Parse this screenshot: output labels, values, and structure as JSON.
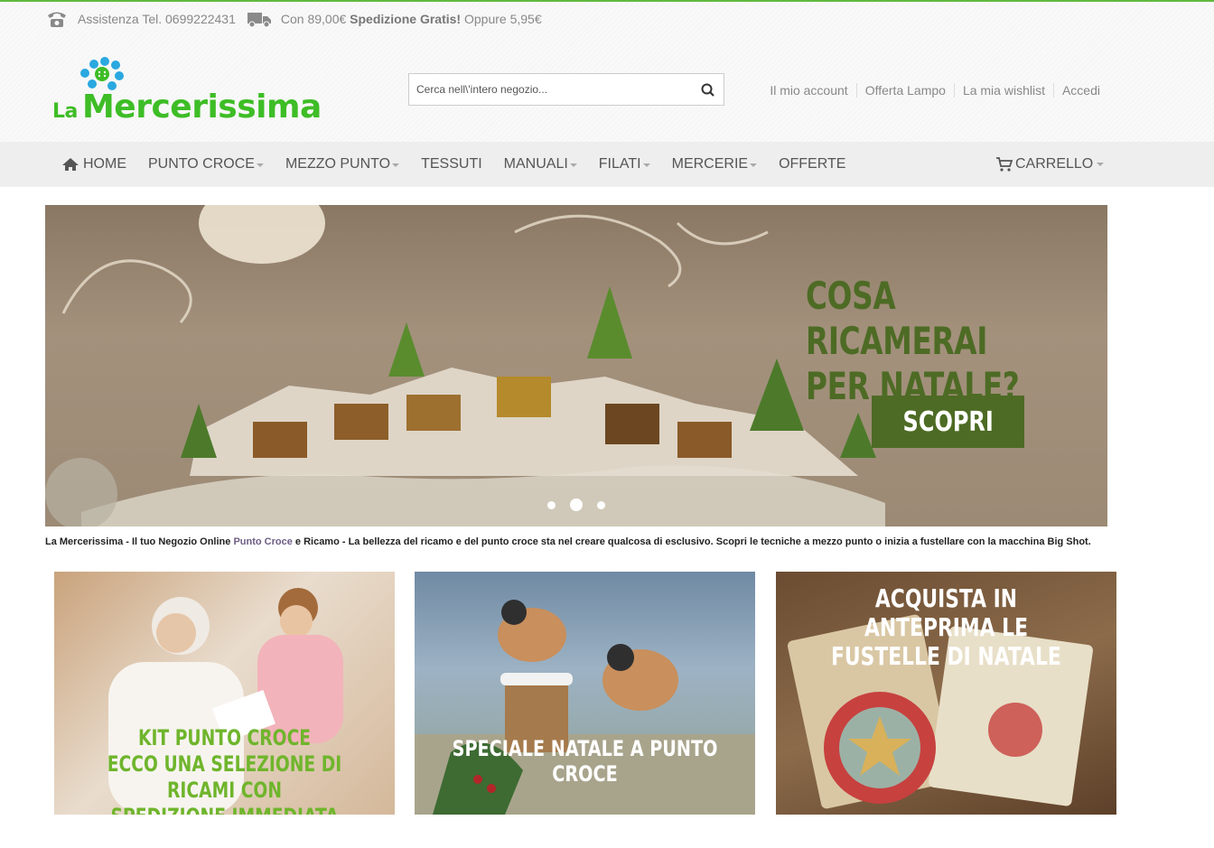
{
  "topbar": {
    "phone_text": "Assistenza Tel. 0699222431",
    "shipping_prefix": "Con 89,00€",
    "shipping_bold": "Spedizione Gratis!",
    "shipping_suffix": "Oppure 5,95€"
  },
  "logo": {
    "text_small": "La",
    "text_big": "Mercerissima"
  },
  "search": {
    "placeholder": "Cerca nell\\'intero negozio..."
  },
  "account_links": [
    "Il mio account",
    "Offerta Lampo",
    "La mia wishlist",
    "Accedi"
  ],
  "nav": {
    "items": [
      {
        "label": "HOME",
        "icon": "home-icon"
      },
      {
        "label": "PUNTO CROCE"
      },
      {
        "label": "MEZZO PUNTO"
      },
      {
        "label": "TESSUTI"
      },
      {
        "label": "MANUALI"
      },
      {
        "label": "FILATI"
      },
      {
        "label": "MERCERIE"
      },
      {
        "label": "OFFERTE"
      }
    ],
    "cart": "CARRELLO"
  },
  "hero": {
    "line1": "COSA RICAMERAI",
    "line2": "PER NATALE?",
    "cta": "SCOPRI",
    "slides": 3,
    "active_slide": 2
  },
  "tagline": {
    "prefix": "La Mercerissima - Il tuo Negozio Online ",
    "link": "Punto Croce",
    "suffix": " e Ricamo - La bellezza del ricamo e del punto croce sta nel creare qualcosa di esclusivo. Scopri le tecniche a mezzo punto o inizia a fustellare con la macchina Big Shot."
  },
  "promos": [
    {
      "lines": [
        "KIT PUNTO CROCE",
        "ECCO UNA SELEZIONE DI RICAMI CON",
        "SPEDIZIONE IMMEDIATA"
      ]
    },
    {
      "lines": [
        "SPECIALE NATALE A PUNTO CROCE"
      ]
    },
    {
      "lines": [
        "ACQUISTA IN ANTEPRIMA LE",
        "FUSTELLE DI NATALE"
      ]
    }
  ],
  "colors": {
    "brand_green": "#3ebd26",
    "dark_green": "#4d6b24",
    "link_purple": "#6e5e86"
  }
}
